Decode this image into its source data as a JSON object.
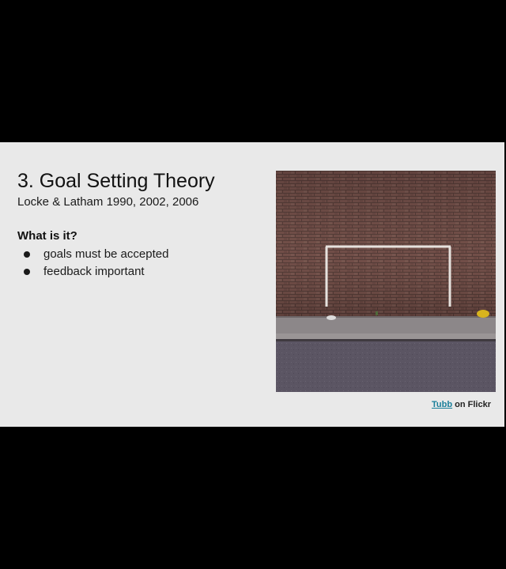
{
  "slide": {
    "title": "3. Goal Setting Theory",
    "subtitle": "Locke & Latham 1990, 2002, 2006",
    "heading": "What is it?",
    "bullets": [
      "goals must be accepted",
      "feedback important"
    ],
    "credit": {
      "link_text": "Tubb",
      "suffix": " on Flickr"
    }
  },
  "colors": {
    "background": "#000000",
    "slide": "#e9e9e9",
    "link": "#1a7f9a",
    "brick": "#6b4a44",
    "road": "#5a5360"
  }
}
